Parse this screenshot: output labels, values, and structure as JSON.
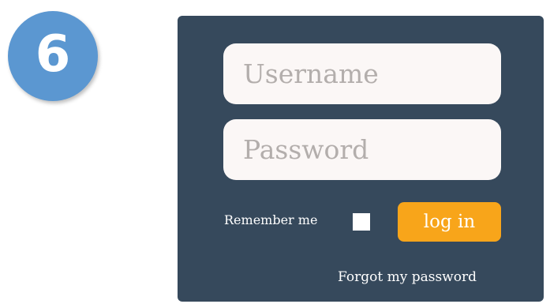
{
  "step_badge": {
    "number": "6",
    "color": "#5b97d1"
  },
  "login_form": {
    "background_color": "#36495c",
    "username": {
      "value": "",
      "placeholder": "Username"
    },
    "password": {
      "value": "",
      "placeholder": "Password"
    },
    "remember_me": {
      "label": "Remember me",
      "checked": false
    },
    "login_button": {
      "label": "log in",
      "color": "#f8a51a"
    },
    "forgot_password_link": "Forgot my password"
  }
}
